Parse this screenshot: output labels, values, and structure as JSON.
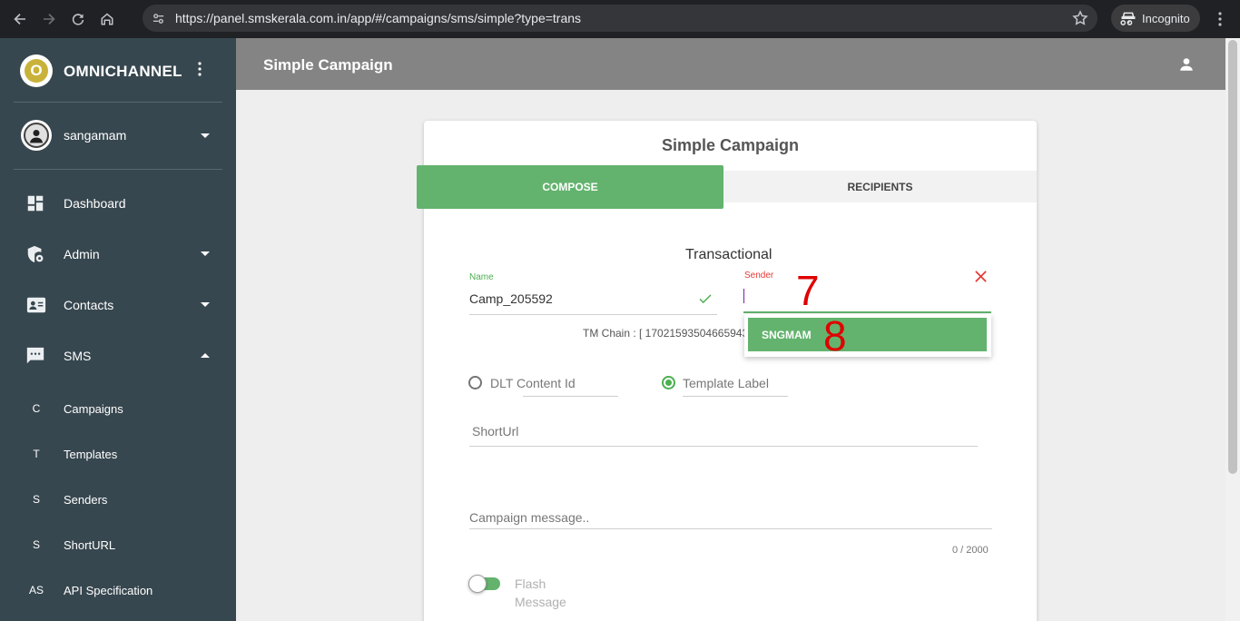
{
  "browser": {
    "url": "https://panel.smskerala.com.in/app/#/campaigns/sms/simple?type=trans",
    "profile_label": "Incognito"
  },
  "sidebar": {
    "brand_letter": "O",
    "brand_title": "OMNICHANNEL",
    "user_name": "sangamam",
    "items": [
      {
        "label": "Dashboard",
        "icon": "dashboard-icon"
      },
      {
        "label": "Admin",
        "icon": "shield-gear-icon"
      },
      {
        "label": "Contacts",
        "icon": "contacts-icon"
      },
      {
        "label": "SMS",
        "icon": "chat-icon"
      }
    ],
    "sms_subitems": [
      {
        "abbr": "C",
        "label": "Campaigns"
      },
      {
        "abbr": "T",
        "label": "Templates"
      },
      {
        "abbr": "S",
        "label": "Senders"
      },
      {
        "abbr": "S",
        "label": "ShortURL"
      },
      {
        "abbr": "AS",
        "label": "API Specification"
      }
    ]
  },
  "topbar": {
    "title": "Simple Campaign"
  },
  "card": {
    "title": "Simple Campaign",
    "tabs": {
      "compose": "COMPOSE",
      "recipients": "RECIPIENTS"
    },
    "type_title": "Transactional",
    "name_label": "Name",
    "name_value": "Camp_205592",
    "sender_label": "Sender",
    "tm_chain": "TM Chain : [ 17021593504665943",
    "sender_option": "SNGMAM",
    "radio_dlt": "DLT Content Id",
    "radio_template": "Template Label",
    "shorturl_placeholder": "ShortUrl",
    "message_placeholder": "Campaign message..",
    "counter": "0 / 2000",
    "flash_line1": "Flash",
    "flash_line2": "Message"
  },
  "annotations": {
    "a7": "7",
    "a8": "8"
  },
  "colors": {
    "accent": "#63b36e",
    "sidebar": "#37474f",
    "error": "#e53935",
    "annotation": "#e00000"
  }
}
